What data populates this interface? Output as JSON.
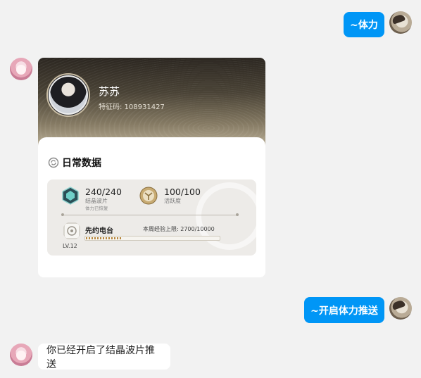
{
  "messages": [
    {
      "from": "user",
      "text": "~体力"
    },
    {
      "from": "user",
      "text": "~开启体力推送"
    },
    {
      "from": "bot",
      "text": "你已经开启了结晶波片推送"
    }
  ],
  "card": {
    "name": "苏苏",
    "uid_label": "特征码: 108931427",
    "section_title": "日常数据",
    "stamina": {
      "value": "240/240",
      "label": "结晶波片",
      "sub": "体力已恢复"
    },
    "activity": {
      "value": "100/100",
      "label": "活跃度"
    },
    "battlepass": {
      "name": "先约电台",
      "limit_label": "本周经验上限: 2700/10000",
      "level": "LV.12",
      "progress": 0.27
    }
  },
  "colors": {
    "user_bubble": "#0096f6",
    "background": "#f2f2f2"
  },
  "icons": [
    "refresh-icon",
    "crystal-icon",
    "activity-icon",
    "radio-icon"
  ]
}
